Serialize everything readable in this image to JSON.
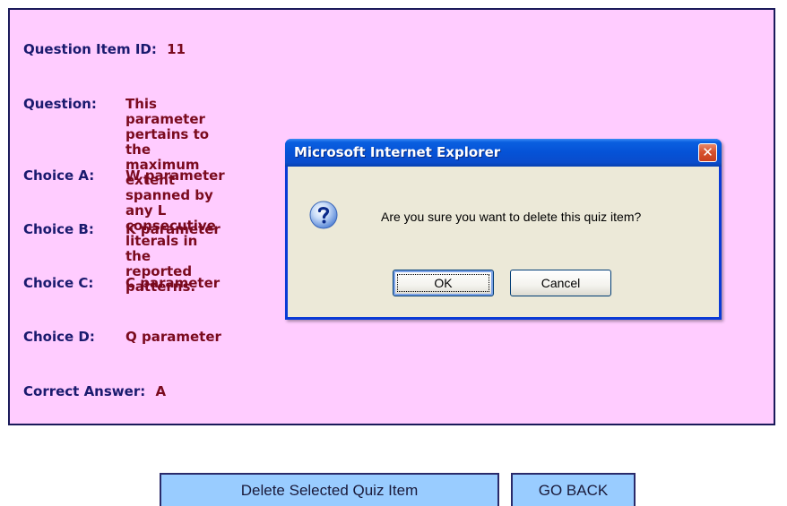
{
  "quiz": {
    "id_label": "Question Item ID:",
    "id_value": "11",
    "question_label": "Question:",
    "question_text": "This parameter pertains to the maximum extent spanned by any L\nconsecutive literals in the reported patterns.",
    "choices": [
      {
        "label": "Choice A:",
        "value": "W parameter"
      },
      {
        "label": "Choice B:",
        "value": "K parameter"
      },
      {
        "label": "Choice C:",
        "value": "C parameter"
      },
      {
        "label": "Choice D:",
        "value": "Q parameter"
      }
    ],
    "correct_label": "Correct Answer:",
    "correct_value": "A"
  },
  "actions": {
    "delete_label": "Delete Selected Quiz Item",
    "back_label": "GO BACK"
  },
  "dialog": {
    "title": "Microsoft Internet Explorer",
    "close_glyph": "✕",
    "icon": "question-icon",
    "message": "Are you sure you want to delete this quiz item?",
    "ok_label": "OK",
    "cancel_label": "Cancel"
  },
  "colors": {
    "panel_bg": "#ffccff",
    "label_color": "#1a1a6e",
    "value_color": "#7a0a1e",
    "button_bg": "#99ccff",
    "titlebar_blue": "#0552d6",
    "dialog_bg": "#ece9d8"
  }
}
